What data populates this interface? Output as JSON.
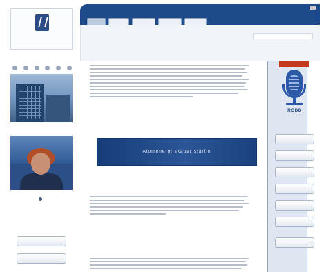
{
  "logo": {
    "icon": "institute-logo-icon",
    "text": ""
  },
  "left": {
    "caption": "",
    "buttons": [
      "",
      ""
    ]
  },
  "nav": {
    "tabs": [
      "",
      "",
      "",
      "",
      ""
    ],
    "right_tab": ""
  },
  "header": {
    "title": "",
    "links": [
      "",
      ""
    ]
  },
  "articles": [
    {
      "date": "",
      "headline": "",
      "more": ""
    },
    {
      "date": "",
      "headline": "",
      "more": ""
    },
    {
      "date": "",
      "headline": ""
    }
  ],
  "banner": {
    "text": "Atomenergi skapar sfärfin"
  },
  "right": {
    "label": "",
    "title": "RÖDD",
    "subtitle": "",
    "buttons": [
      "",
      "",
      "",
      "",
      "",
      "",
      ""
    ]
  },
  "colors": {
    "nav": "#1d4a89",
    "link": "#1f4f8f",
    "accent": "#c43a1c",
    "mic": "#2c58a6"
  }
}
